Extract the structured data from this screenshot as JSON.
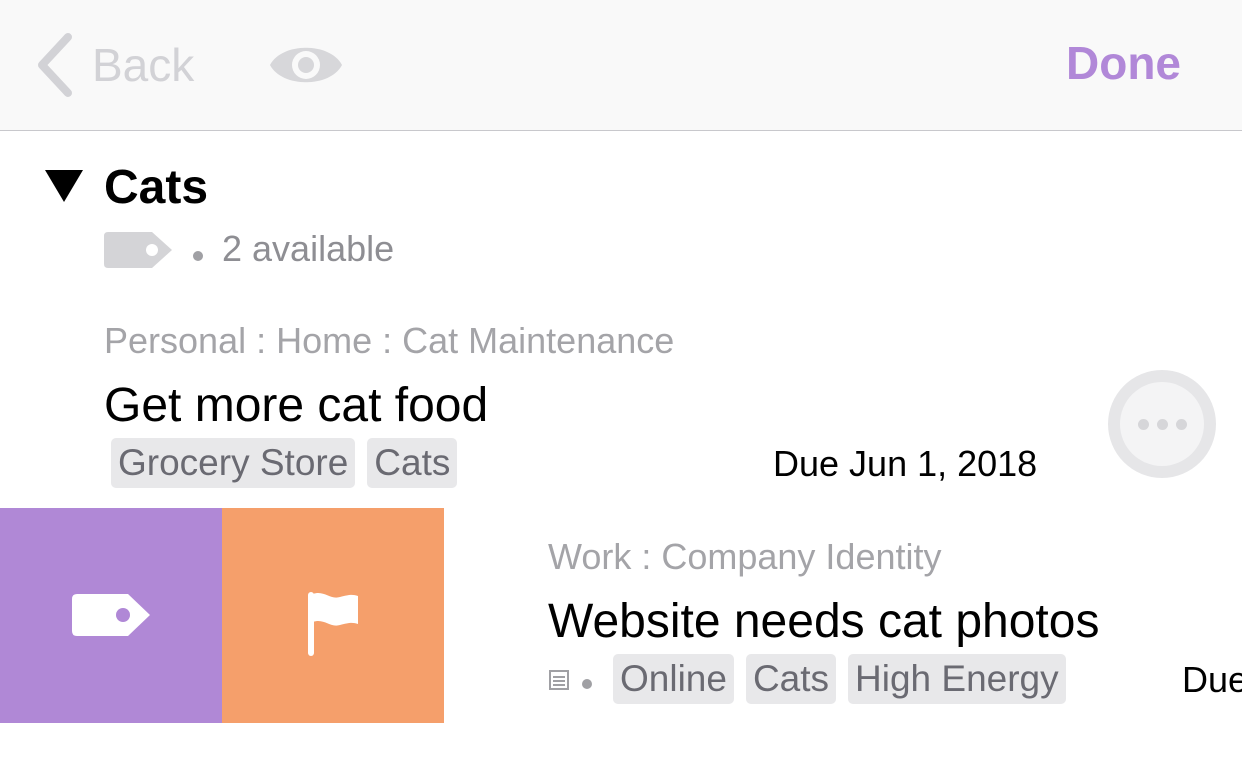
{
  "navbar": {
    "back_label": "Back",
    "done_label": "Done",
    "icons": [
      "chevron-left-icon",
      "eye-icon"
    ],
    "colors": {
      "accent": "#b188d8",
      "disabled": "#d2d2d6"
    }
  },
  "group": {
    "title": "Cats",
    "count_text": "2 available",
    "icons": [
      "disclosure-triangle-icon",
      "tag-icon"
    ]
  },
  "tasks": [
    {
      "project": "Personal : Home : Cat Maintenance",
      "title": "Get more cat food",
      "tags": [
        "Grocery Store",
        "Cats"
      ],
      "due": "Due Jun 1, 2018"
    },
    {
      "project": "Work : Company Identity",
      "title": "Website needs cat photos",
      "tags": [
        "Online",
        "Cats",
        "High Energy"
      ],
      "due": "Due"
    }
  ],
  "swipe_actions": [
    {
      "name": "tag",
      "icon": "tag-icon",
      "color": "#b088d6"
    },
    {
      "name": "flag",
      "icon": "flag-icon",
      "color": "#f59f6b"
    }
  ]
}
